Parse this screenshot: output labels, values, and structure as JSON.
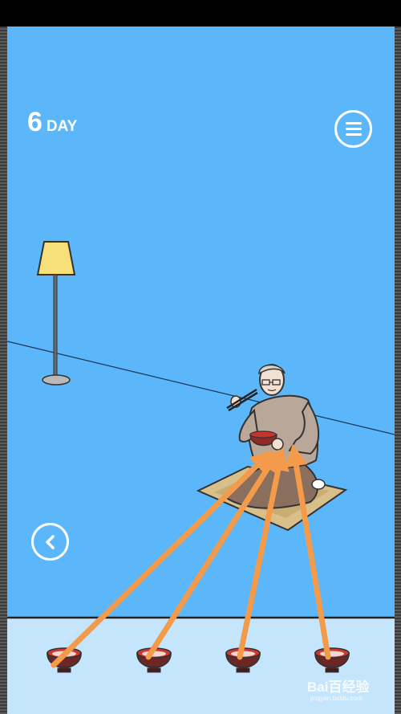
{
  "hud": {
    "day_number": "6",
    "day_label": "DAY",
    "menu_icon": "hamburger-menu-icon",
    "back_icon": "chevron-left-icon"
  },
  "scene": {
    "background_color": "#5bb7fa",
    "floor_color": "#c5e5fd",
    "character": "elderly man eating from bowl with chopsticks",
    "bowl_count": 4,
    "arrow_color": "#f49a4b"
  },
  "watermark": {
    "text": "Bai百经验",
    "sub": "jingyan.baidu.com"
  }
}
